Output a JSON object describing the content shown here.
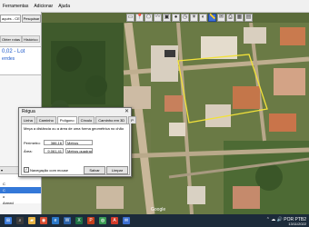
{
  "menubar": {
    "items": [
      "Ferramentas",
      "Adicionar",
      "Ajuda"
    ]
  },
  "left_panel": {
    "search_value": "açués - CE",
    "search_button": "Pesquisar",
    "tabs": [
      "Obter rotas",
      "Histórico"
    ],
    "result_title": "0,02 - Lot",
    "result_sub": "errdes",
    "places_rows": [
      "",
      "C",
      "C",
      "o",
      "Armed"
    ]
  },
  "dialog": {
    "title": "Régua",
    "close": "✕",
    "tabs": [
      "Linha",
      "Caminho",
      "Polígono",
      "Círculo",
      "Caminho em 3D",
      "P"
    ],
    "active_tab_index": 2,
    "description": "Meça a distância ou a área de uma forma geométrica no chão",
    "perimeter_label": "Perímetro:",
    "perimeter_value": "386,16",
    "perimeter_unit": "Metros",
    "area_label": "Área:",
    "area_value": "9.061,41",
    "area_unit": "Metros quadrados",
    "navigation_label": "Navegação com mouse",
    "navigation_checked": true,
    "save_button": "Salvar",
    "clear_button": "Limpar"
  },
  "map": {
    "polygon_color": "#f2e23a",
    "copyright": "Google"
  },
  "taskbar": {
    "tray_text": "⌃ ☁ 🔊 POR PTB2",
    "date": "13/11/2022"
  }
}
